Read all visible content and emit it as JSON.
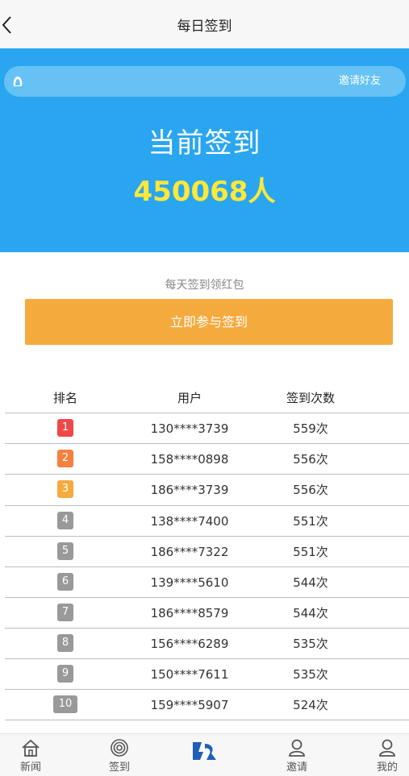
{
  "header": {
    "title": "每日签到",
    "back_icon": "chevron-left-icon"
  },
  "banner": {
    "marquee_text": "邀请好友",
    "count_label": "当前签到",
    "count_value": "450068人"
  },
  "sign": {
    "hint": "每天签到领红包",
    "button_label": "立即参与签到"
  },
  "ranking": {
    "columns": [
      "排名",
      "用户",
      "签到次数"
    ],
    "rows": [
      {
        "rank": "1",
        "user": "130****3739",
        "count": "559次",
        "color": "#f04848"
      },
      {
        "rank": "2",
        "user": "158****0898",
        "count": "556次",
        "color": "#f5813e"
      },
      {
        "rank": "3",
        "user": "186****3739",
        "count": "556次",
        "color": "#f5aa3e"
      },
      {
        "rank": "4",
        "user": "138****7400",
        "count": "551次",
        "color": "#999999"
      },
      {
        "rank": "5",
        "user": "186****7322",
        "count": "551次",
        "color": "#999999"
      },
      {
        "rank": "6",
        "user": "139****5610",
        "count": "544次",
        "color": "#999999"
      },
      {
        "rank": "7",
        "user": "186****8579",
        "count": "544次",
        "color": "#999999"
      },
      {
        "rank": "8",
        "user": "156****6289",
        "count": "535次",
        "color": "#999999"
      },
      {
        "rank": "9",
        "user": "150****7611",
        "count": "535次",
        "color": "#999999"
      },
      {
        "rank": "10",
        "user": "159****5907",
        "count": "524次",
        "color": "#999999"
      }
    ]
  },
  "tabbar": {
    "items": [
      {
        "label": "新闻",
        "icon": "home-icon"
      },
      {
        "label": "签到",
        "icon": "target-icon"
      },
      {
        "label": "",
        "icon": "logo-icon"
      },
      {
        "label": "邀请",
        "icon": "user-icon"
      },
      {
        "label": "我的",
        "icon": "user-icon"
      }
    ]
  },
  "colors": {
    "banner": "#2aa6f0",
    "count_value": "#ffe83a",
    "button": "#f5aa3e"
  }
}
